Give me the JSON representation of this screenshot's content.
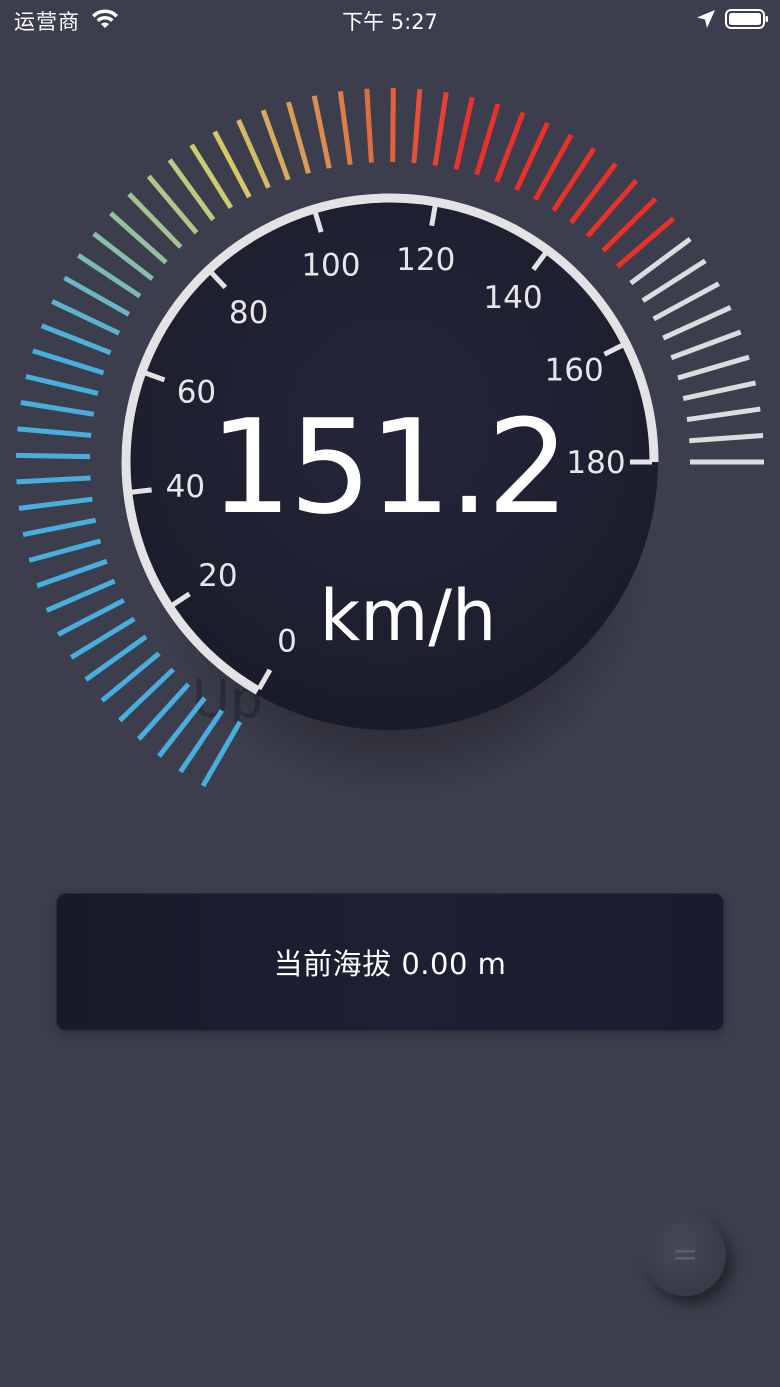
{
  "status_bar": {
    "carrier": "运营商",
    "time": "下午 5:27",
    "icons": [
      "wifi-icon",
      "location-arrow-icon",
      "battery-icon"
    ]
  },
  "speedometer": {
    "speed": "151.2",
    "unit": "km/h",
    "scale_labels": [
      "0",
      "20",
      "40",
      "60",
      "80",
      "100",
      "120",
      "140",
      "160",
      "180"
    ],
    "scale_min": 0,
    "scale_max": 180,
    "background_text": "Up",
    "outer_ticks": {
      "count": 60,
      "colors": {
        "low": "#48aede",
        "mid": "#d3cf6c",
        "high": "#e93029",
        "inactive": "#dcdce0"
      }
    },
    "colors": {
      "ring": "#e3e3e6",
      "dial_face": "#1f2130",
      "page_background": "#3d3e4d"
    }
  },
  "altitude": {
    "label": "当前海拔 0.00 m"
  },
  "menu_button": {
    "icon": "menu-icon"
  }
}
